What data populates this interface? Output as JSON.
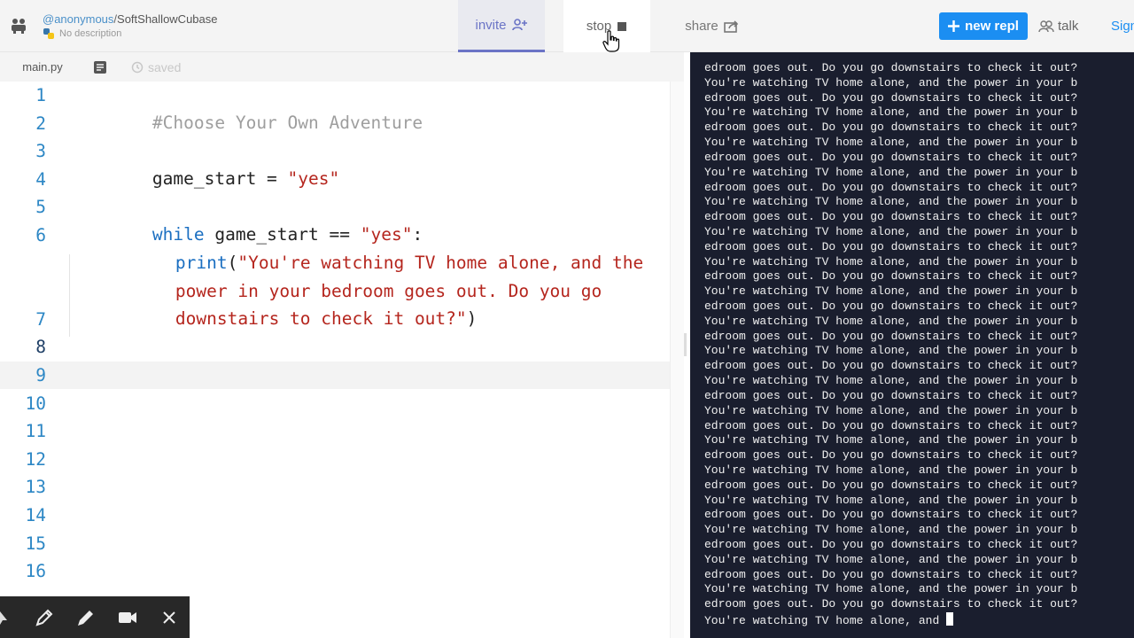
{
  "header": {
    "owner": "@anonymous",
    "separator": "/",
    "repl_name": "SoftShallowCubase",
    "description": "No description",
    "invite_label": "invite",
    "stop_label": "stop",
    "share_label": "share",
    "new_repl_label": "new repl",
    "talk_label": "talk",
    "signin_label": "Sign"
  },
  "editor": {
    "file_tab": "main.py",
    "saved_status": "saved",
    "line_numbers": [
      "1",
      "2",
      "3",
      "4",
      "5",
      "6",
      "7",
      "8",
      "9",
      "10",
      "11",
      "12",
      "13",
      "14",
      "15",
      "16"
    ],
    "code": {
      "line1": "#Choose Your Own Adventure",
      "line3_var": "game_start = ",
      "line3_str": "\"yes\"",
      "line5_kw": "while",
      "line5_mid": " game_start == ",
      "line5_str": "\"yes\"",
      "line5_end": ":",
      "line6_fn": "print",
      "line6_paren": "(",
      "line6_str_a": "\"You're watching TV home alone, and the",
      "line6_str_b": "power in your bedroom goes out. Do you go",
      "line6_str_c": "downstairs to check it out?\"",
      "line6_close": ")"
    }
  },
  "console": {
    "line_a": "edroom goes out. Do you go downstairs to check it out?",
    "line_b": "You're watching TV home alone, and the power in your b",
    "last_line": "You're watching TV home alone, and "
  },
  "colors": {
    "accent": "#1b8ef2",
    "invite": "#6b74c6",
    "console_bg": "#1a1e2e",
    "line_number": "#2d87c5",
    "string": "#b5261e",
    "keyword": "#1b6fc1"
  },
  "icons": {
    "logo": "repl-logo-icon",
    "python": "python-icon",
    "invite": "add-user-icon",
    "stop": "stop-square-icon",
    "share": "share-icon",
    "new_repl": "plus-icon",
    "talk": "people-icon",
    "file": "file-list-icon",
    "saved": "clock-icon",
    "pointer": "pointer-icon",
    "pen": "pen-icon",
    "marker": "marker-icon",
    "camera": "camera-icon",
    "close": "close-icon"
  }
}
